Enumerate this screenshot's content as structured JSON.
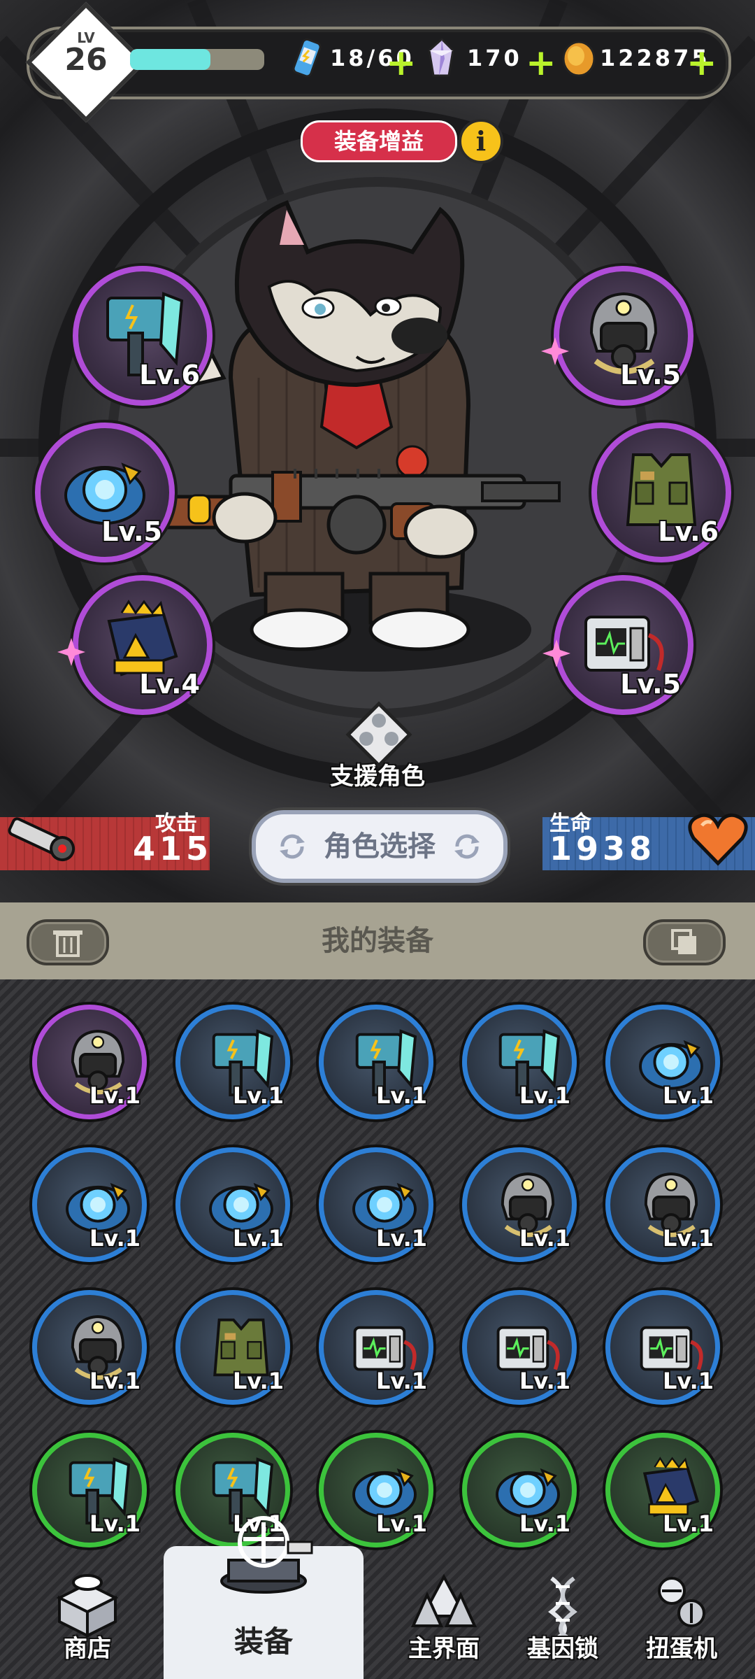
{
  "player": {
    "level_label": "LV",
    "level": "26",
    "xp_fraction": 0.6
  },
  "resources": {
    "energy": "18/60",
    "gems": "170",
    "coins": "122875"
  },
  "banner": {
    "title": "装备增益"
  },
  "equipped": {
    "left": [
      "Lv.6",
      "Lv.5",
      "Lv.4"
    ],
    "right": [
      "Lv.5",
      "Lv.6",
      "Lv.5"
    ],
    "left_icons": [
      "axe-icon",
      "core-icon",
      "gauntlet-icon"
    ],
    "right_icons": [
      "gas-mask-helmet-icon",
      "tactical-vest-icon",
      "heart-monitor-icon"
    ]
  },
  "support": {
    "label": "支援角色"
  },
  "stats": {
    "attack_label": "攻击",
    "attack_value": "415",
    "hp_label": "生命",
    "hp_value": "1938"
  },
  "character_select": {
    "label": "角色选择"
  },
  "inventory": {
    "title": "我的装备",
    "items": [
      {
        "lv": "Lv.1",
        "rarity": "purple",
        "icon": "gas-mask-helmet-icon"
      },
      {
        "lv": "Lv.1",
        "rarity": "blue",
        "icon": "axe-icon"
      },
      {
        "lv": "Lv.1",
        "rarity": "blue",
        "icon": "axe-icon"
      },
      {
        "lv": "Lv.1",
        "rarity": "blue",
        "icon": "axe-icon"
      },
      {
        "lv": "Lv.1",
        "rarity": "blue",
        "icon": "core-icon"
      },
      {
        "lv": "Lv.1",
        "rarity": "blue",
        "icon": "core-icon"
      },
      {
        "lv": "Lv.1",
        "rarity": "blue",
        "icon": "core-icon"
      },
      {
        "lv": "Lv.1",
        "rarity": "blue",
        "icon": "core-icon"
      },
      {
        "lv": "Lv.1",
        "rarity": "blue",
        "icon": "gas-mask-helmet-icon"
      },
      {
        "lv": "Lv.1",
        "rarity": "blue",
        "icon": "gas-mask-helmet-icon"
      },
      {
        "lv": "Lv.1",
        "rarity": "blue",
        "icon": "gas-mask-helmet-icon"
      },
      {
        "lv": "Lv.1",
        "rarity": "blue",
        "icon": "tactical-vest-icon"
      },
      {
        "lv": "Lv.1",
        "rarity": "blue",
        "icon": "heart-monitor-icon"
      },
      {
        "lv": "Lv.1",
        "rarity": "blue",
        "icon": "heart-monitor-icon"
      },
      {
        "lv": "Lv.1",
        "rarity": "blue",
        "icon": "heart-monitor-icon"
      },
      {
        "lv": "Lv.1",
        "rarity": "green",
        "icon": "axe-icon"
      },
      {
        "lv": "Lv.1",
        "rarity": "green",
        "icon": "axe-icon"
      },
      {
        "lv": "Lv.1",
        "rarity": "green",
        "icon": "core-icon"
      },
      {
        "lv": "Lv.1",
        "rarity": "green",
        "icon": "core-icon"
      },
      {
        "lv": "Lv.1",
        "rarity": "green",
        "icon": "gauntlet-icon"
      }
    ]
  },
  "nav": {
    "shop": "商店",
    "equipment": "装备",
    "main": "主界面",
    "gene_lock": "基因锁",
    "gacha": "扭蛋机"
  },
  "colors": {
    "rarity_purple": "#b04cd8",
    "rarity_blue": "#2d7fd6",
    "rarity_green": "#3cc33c",
    "banner": "#d6304a",
    "attack": "#b83838",
    "hp": "#3d6aa8"
  }
}
